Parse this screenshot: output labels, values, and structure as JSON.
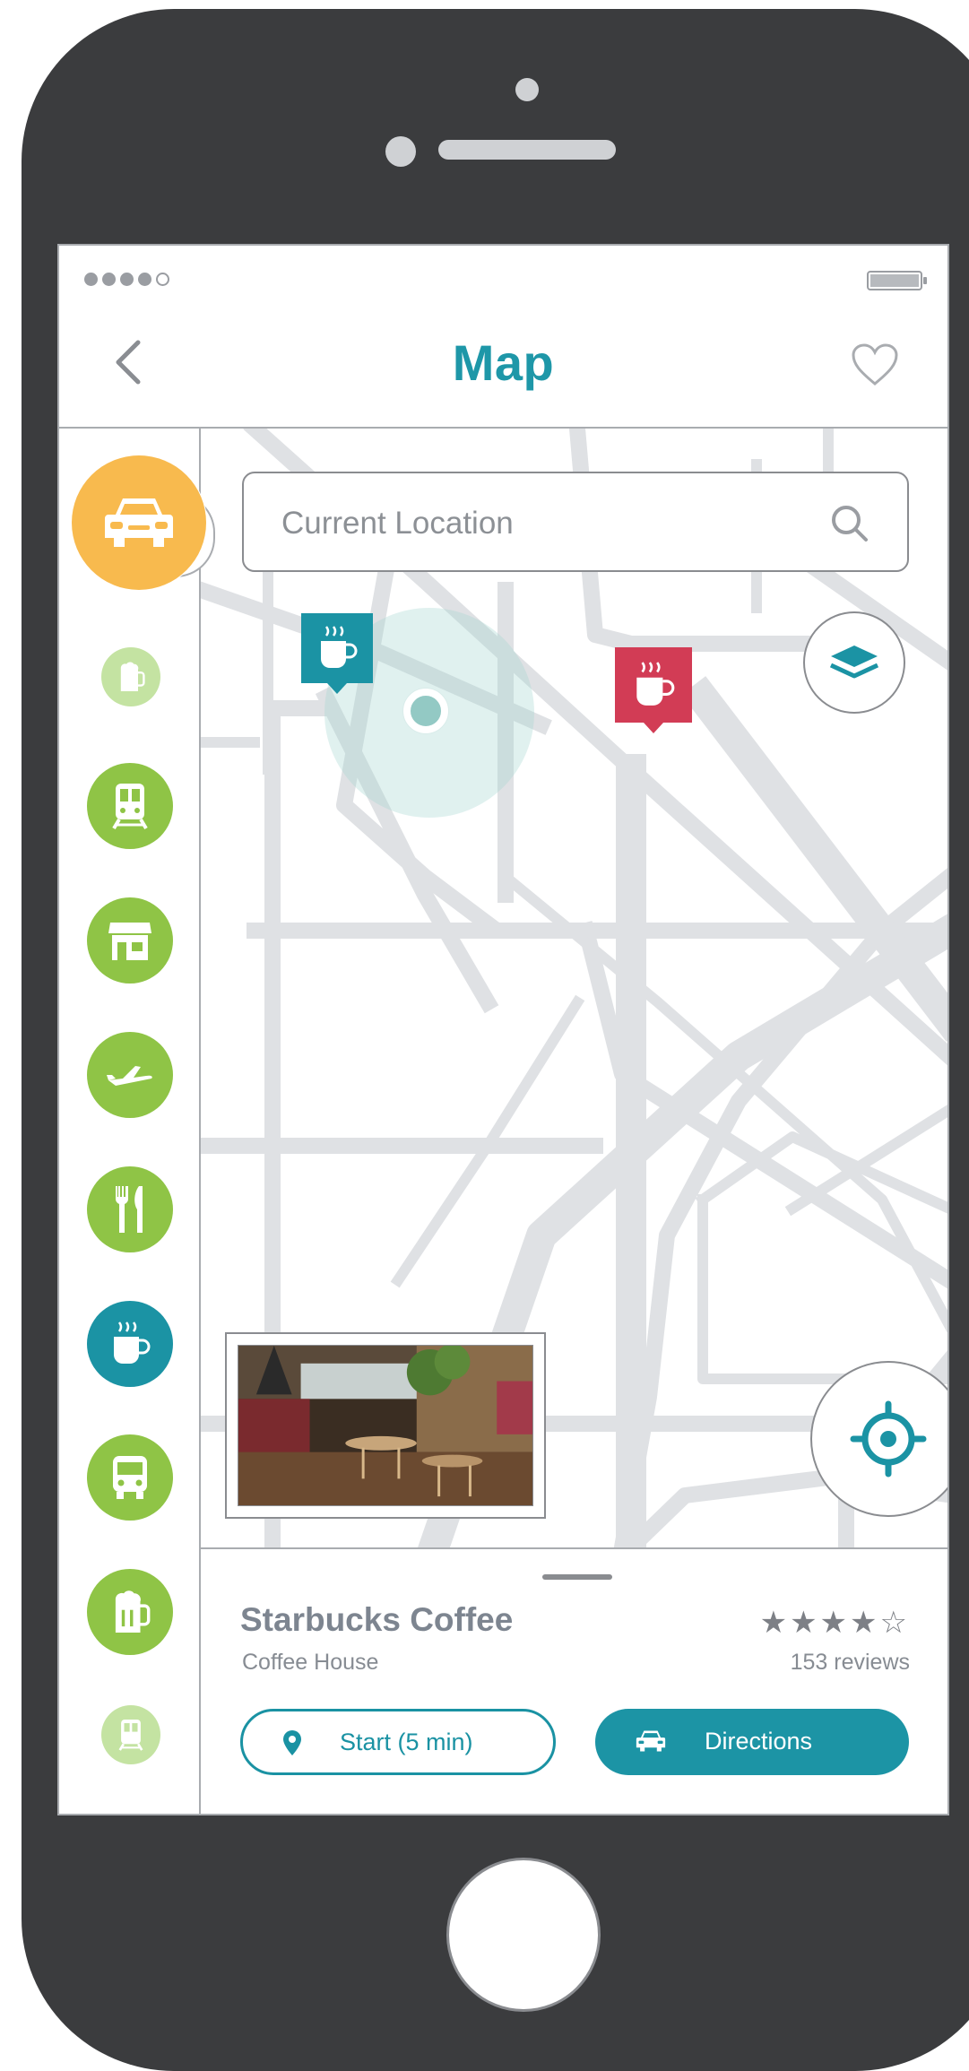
{
  "header": {
    "title": "Map"
  },
  "search": {
    "placeholder": "Current Location"
  },
  "sidebar": {
    "items": [
      {
        "icon": "car-icon",
        "state": "selected",
        "color": "#f8ba4e"
      },
      {
        "icon": "beer-mug-icon",
        "state": "faded",
        "color": "#c4e3a2"
      },
      {
        "icon": "train-icon",
        "color": "#8fc446"
      },
      {
        "icon": "store-icon",
        "color": "#8fc446"
      },
      {
        "icon": "airplane-icon",
        "color": "#8fc446"
      },
      {
        "icon": "fork-knife-icon",
        "color": "#8fc446"
      },
      {
        "icon": "coffee-cup-icon",
        "state": "active",
        "color": "#1b93a4"
      },
      {
        "icon": "bus-icon",
        "color": "#8fc446"
      },
      {
        "icon": "beer-mug-icon",
        "color": "#8fc446"
      },
      {
        "icon": "train-icon",
        "state": "faded",
        "color": "#c4e3a2"
      }
    ]
  },
  "map": {
    "pins": [
      {
        "icon": "coffee-cup-icon",
        "color": "#1b93a4"
      },
      {
        "icon": "coffee-cup-icon",
        "color": "#d23c55"
      }
    ],
    "controls": [
      "layers-icon",
      "crosshair-icon"
    ]
  },
  "place": {
    "name": "Starbucks Coffee",
    "category": "Coffee House",
    "stars": "★★★★☆",
    "rating": 4.5,
    "reviews": "153 reviews",
    "start_label": "Start (5 min)",
    "directions_label": "Directions"
  },
  "colors": {
    "accent": "#1e97a8",
    "category_green": "#8fc446",
    "category_selected": "#f8ba4e",
    "pin_red": "#d23c55",
    "phone_body": "#3b3c3e"
  }
}
